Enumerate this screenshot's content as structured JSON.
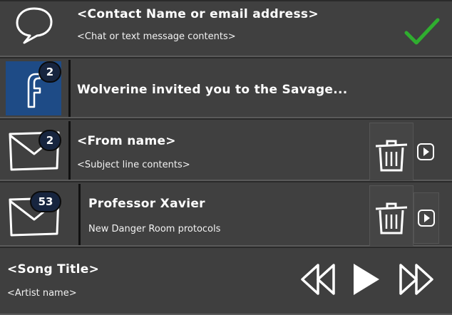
{
  "chat": {
    "contact": "<Contact Name or email address>",
    "message": "<Chat or text message contents>"
  },
  "facebook": {
    "badge": "2",
    "text": "Wolverine invited you to the Savage..."
  },
  "email1": {
    "badge": "2",
    "from": "<From name>",
    "subject": "<Subject line contents>"
  },
  "email2": {
    "badge": "53",
    "from": "Professor Xavier",
    "subject": "New Danger Room protocols"
  },
  "media": {
    "song": "<Song Title>",
    "artist": "<Artist name>"
  },
  "colors": {
    "accent_check": "#2fae2f",
    "facebook_blue": "#1e4b86",
    "badge_bg": "#17253f"
  }
}
